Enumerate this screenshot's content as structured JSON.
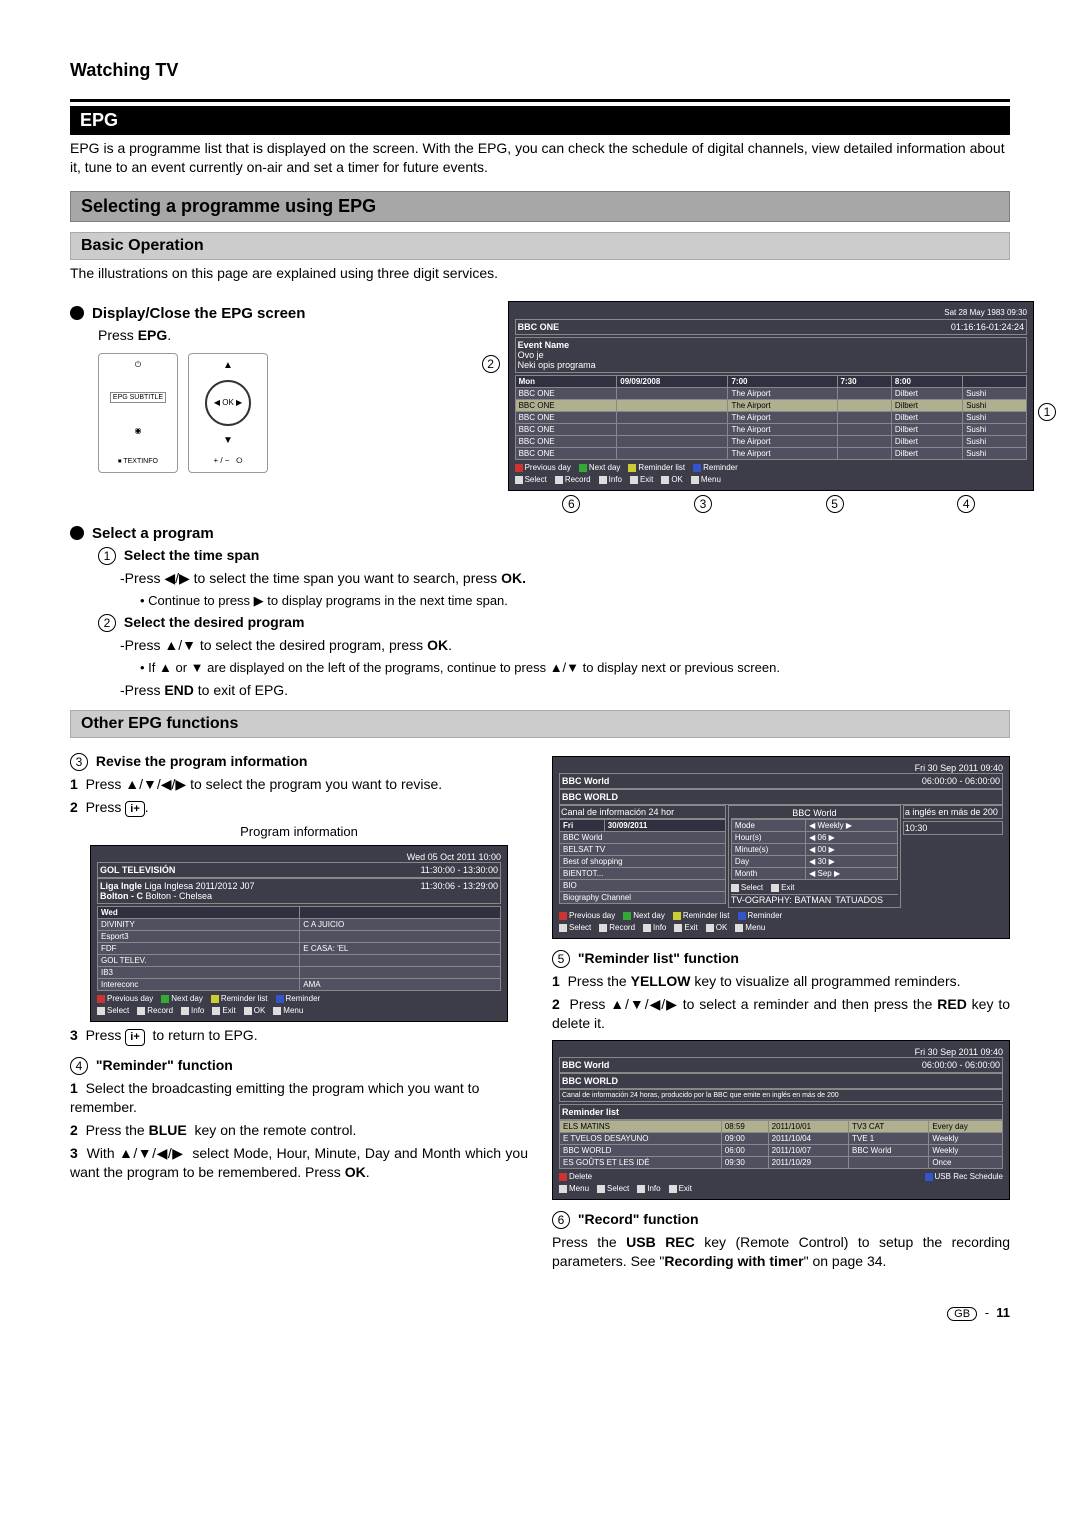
{
  "header": {
    "watching": "Watching TV",
    "epg": "EPG"
  },
  "intro": "EPG is a programme list that is displayed on the screen. With the EPG, you can check the schedule of digital channels, view detailed information about it, tune to an event currently on-air and set a timer for future events.",
  "selecting_title": "Selecting a programme using EPG",
  "basic_op_title": "Basic Operation",
  "basic_op_note": "The illustrations on this page are explained using three digit services.",
  "display_close_title": "Display/Close the EPG screen",
  "press_epg_pre": "Press ",
  "press_epg_key": "EPG",
  "press_epg_post": ".",
  "select_prog_title": "Select a program",
  "step1_title": "Select the time span",
  "step1_l1_a": "-Press ",
  "step1_l1_b": " to select the time span you want to search, press ",
  "step1_ok": "OK.",
  "step1_bullet": "• Continue to press ▶ to display programs in the next time span.",
  "step2_title": "Select the desired program",
  "step2_l1_a": "-Press ",
  "step2_l1_b": " to select the desired program, press ",
  "step2_ok": "OK",
  "step2_bullet_a": "• If ",
  "step2_bullet_b": " are displayed on the left of the programs, continue to press ",
  "step2_bullet_c": " to display next or previous screen.",
  "step2_end_a": "-Press ",
  "step2_end_key": "END",
  "step2_end_b": " to exit of EPG.",
  "other_title": "Other EPG functions",
  "s3_title": "Revise the program information",
  "s3_1_a": "Press ",
  "s3_1_b": " to select the program you want to revise.",
  "s3_2_a": "Press ",
  "s3_2_b": ".",
  "prog_info_caption": "Program information",
  "s3_3_a": "Press ",
  "s3_3_b": " to return to EPG.",
  "s4_title": "\"Reminder\" function",
  "s4_1": "Select the broadcasting emitting the program which you want to remember.",
  "s4_2_a": "Press the ",
  "s4_2_key": "BLUE",
  "s4_2_b": " key on the remote control.",
  "s4_3_a": "With ",
  "s4_3_b": " select Mode, Hour, Minute, Day and Month which you want the program to be remembered. Press ",
  "s4_3_ok": "OK",
  "s5_title": "\"Reminder list\" function",
  "s5_1_a": "Press the ",
  "s5_1_key": "YELLOW",
  "s5_1_b": " key to visualize all programmed reminders.",
  "s5_2_a": "Press ",
  "s5_2_b": " to select a reminder and then press the ",
  "s5_2_key": "RED",
  "s5_2_c": " key to delete it.",
  "s6_title": "\"Record\" function",
  "s6_a": "Press the ",
  "s6_key": "USB REC",
  "s6_b": " key (Remote Control) to setup the recording parameters. See \"",
  "s6_link": "Recording with timer",
  "s6_c": "\" on page 34.",
  "footer_gb": "GB",
  "footer_page": "11",
  "arrows": {
    "lr": "◀/▶",
    "ud": "▲/▼",
    "all": "▲/▼/◀/▶",
    "u_or_d": "▲ or ▼",
    "r": "▶"
  },
  "fig1": {
    "date": "Sat 28 May 1983  09:30",
    "chan": "BBC ONE",
    "time": "01:16:16-01:24:24",
    "event": "Event Name",
    "ovo": "Ovo je",
    "opis": "Neki opis programa",
    "hdr_date": "09/09/2008",
    "times": [
      "7:00",
      "7:30",
      "8:00"
    ],
    "day": "Mon",
    "rows": [
      {
        "c": "BBC ONE",
        "p1": "The Airport",
        "p2": "Dilbert",
        "p3": "Sushi"
      },
      {
        "c": "BBC ONE",
        "p1": "The Airport",
        "p2": "Dilbert",
        "p3": "Sushi"
      },
      {
        "c": "BBC ONE",
        "p1": "The Airport",
        "p2": "Dilbert",
        "p3": "Sushi"
      },
      {
        "c": "BBC ONE",
        "p1": "The Airport",
        "p2": "Dilbert",
        "p3": "Sushi"
      },
      {
        "c": "BBC ONE",
        "p1": "The Airport",
        "p2": "Dilbert",
        "p3": "Sushi"
      },
      {
        "c": "BBC ONE",
        "p1": "The Airport",
        "p2": "Dilbert",
        "p3": "Sushi"
      }
    ],
    "legend": [
      "Previous day",
      "Next day",
      "Reminder list",
      "Reminder",
      "Select",
      "Record",
      "Info",
      "Exit",
      "OK",
      "Menu"
    ]
  },
  "fig2": {
    "date": "Wed 05 Oct 2011 10:00",
    "chan": "GOL TELEVISIÓN",
    "time": "11:30:00 - 13:30:00",
    "match": "Liga Inglesa 2011/2012 J07",
    "sub": "Bolton - Chelsea",
    "time2": "11:30:06 - 13:29:00",
    "day": "Wed",
    "rows": [
      "DIVINITY",
      "Esport3",
      "FDF",
      "GOL TELEV.",
      "IB3",
      "Intereconc"
    ],
    "right": [
      "C A JUICIO",
      "E CASA: 'EL",
      "AMA"
    ],
    "legend": [
      "Previous day",
      "Next day",
      "Reminder list",
      "Reminder",
      "Select",
      "Record",
      "Info",
      "Exit",
      "OK",
      "Menu"
    ]
  },
  "fig3": {
    "date": "Fri 30 Sep 2011  09:40",
    "chan": "BBC World",
    "time": "06:00:00 - 06:00:00",
    "sub": "BBC WORLD",
    "panel": "BBC World",
    "desc_l": "Canal de información 24 hor",
    "desc_r": "a inglés en más de 200",
    "mode": "Mode",
    "mode_v": "Weekly",
    "hour": "Hour(s)",
    "hour_v": "06",
    "min": "Minute(s)",
    "min_v": "00",
    "day": "Day",
    "day_v": "30",
    "month": "Month",
    "month_v": "Sep",
    "fri": "Fri",
    "fri_d": "30/09/2011",
    "t2": "10:30",
    "chs": [
      "BBC World",
      "BELSAT TV",
      "Best of shopping",
      "BIENTOT...",
      "BIO",
      "Biography Channel"
    ],
    "prog": "TV-OGRAPHY: BATMAN",
    "prog2": "TATUADOS",
    "sel": "Select",
    "exit": "Exit",
    "legend": [
      "Previous day",
      "Next day",
      "Reminder list",
      "Reminder",
      "Select",
      "Record",
      "Info",
      "Exit",
      "OK",
      "Menu"
    ]
  },
  "fig4": {
    "date": "Fri 30 Sep 2011  09:40",
    "chan": "BBC World",
    "time": "06:00:00 - 06:00:00",
    "sub": "BBC WORLD",
    "desc": "Canal de información 24 horas, producido por la BBC que emite en inglés en más de 200",
    "rl": "Reminder list",
    "rows": [
      {
        "c": "ELS MATINS",
        "t": "08:59",
        "d": "2011/10/01",
        "ch": "TV3 CAT",
        "m": "Every day"
      },
      {
        "c": "E TVELOS DESAYUNO",
        "t": "09:00",
        "d": "2011/10/04",
        "ch": "TVE 1",
        "m": "Weekly"
      },
      {
        "c": "BBC WORLD",
        "t": "06:00",
        "d": "2011/10/07",
        "ch": "BBC World",
        "m": "Weekly"
      },
      {
        "c": "ES GOÛTS ET LES IDÉ",
        "t": "09:30",
        "d": "2011/10/29",
        "ch": "",
        "m": "Once"
      }
    ],
    "legend": [
      "Delete",
      "USB Rec Schedule",
      "Menu",
      "Select",
      "Info",
      "Exit"
    ]
  }
}
